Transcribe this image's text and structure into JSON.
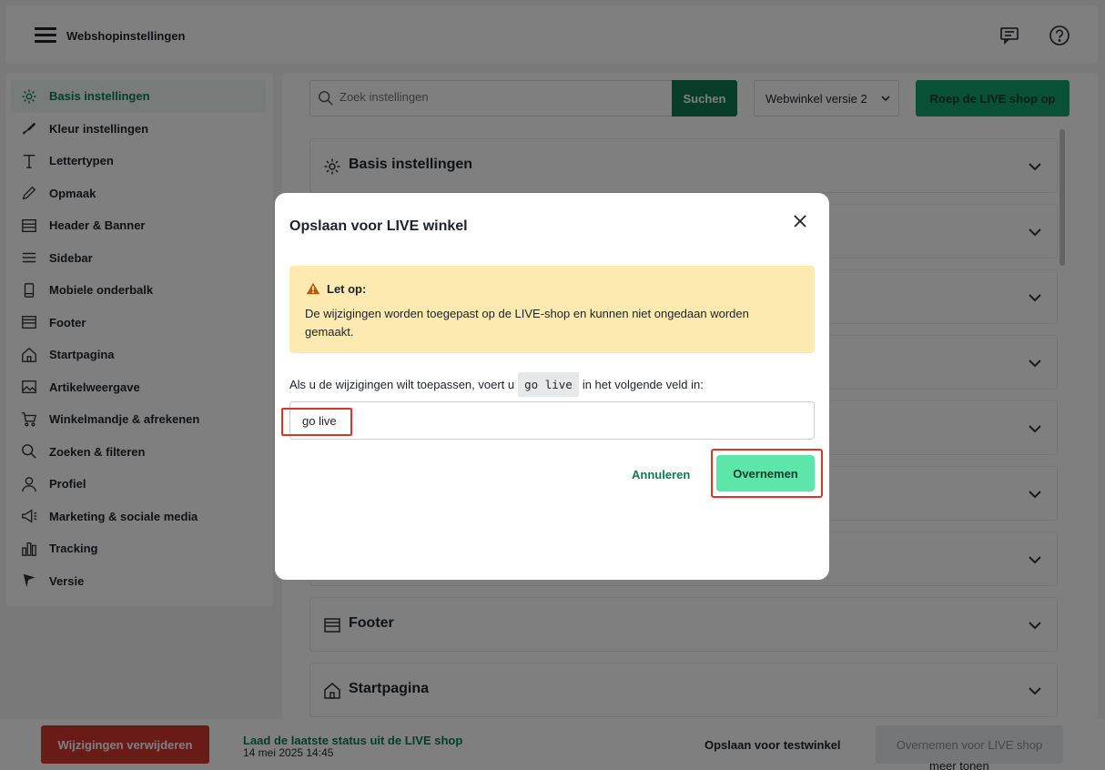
{
  "header": {
    "title": "Webshopinstellingen",
    "icons": [
      "menu-icon",
      "chat-icon",
      "help-icon"
    ]
  },
  "sidebar": {
    "items": [
      {
        "label": "Basis instellingen",
        "icon": "gear-icon",
        "active": true
      },
      {
        "label": "Kleur instellingen",
        "icon": "brush-icon"
      },
      {
        "label": "Lettertypen",
        "icon": "font-icon"
      },
      {
        "label": "Opmaak",
        "icon": "pencil-icon"
      },
      {
        "label": "Header & Banner",
        "icon": "banner-icon"
      },
      {
        "label": "Sidebar",
        "icon": "list-icon"
      },
      {
        "label": "Mobiele onderbalk",
        "icon": "mobile-icon"
      },
      {
        "label": "Footer",
        "icon": "footer-icon"
      },
      {
        "label": "Startpagina",
        "icon": "home-icon"
      },
      {
        "label": "Artikelweergave",
        "icon": "image-icon"
      },
      {
        "label": "Winkelmandje & afrekenen",
        "icon": "cart-icon"
      },
      {
        "label": "Zoeken & filteren",
        "icon": "search-icon"
      },
      {
        "label": "Profiel",
        "icon": "user-icon"
      },
      {
        "label": "Marketing & sociale media",
        "icon": "megaphone-icon"
      },
      {
        "label": "Tracking",
        "icon": "chart-icon"
      },
      {
        "label": "Versie",
        "icon": "flag-icon"
      }
    ]
  },
  "toolbar": {
    "search_placeholder": "Zoek instellingen",
    "search_button": "Suchen",
    "version_selected": "Webwinkel versie 2",
    "live_button": "Roep de LIVE shop op"
  },
  "sections": [
    {
      "title": "Basis instellingen",
      "icon": "gear-icon"
    },
    {
      "title": "Footer",
      "icon": "footer-icon"
    },
    {
      "title": "Startpagina",
      "icon": "home-icon"
    }
  ],
  "footer": {
    "delete_button": "Wijzigingen verwijderen",
    "load_link": "Laad de laatste status uit de LIVE shop",
    "load_time": "14 mei 2025 14:45",
    "save_test": "Opslaan voor testwinkel",
    "take_live": "Overnemen voor LIVE shop",
    "more": "meer tonen"
  },
  "modal": {
    "title": "Opslaan voor LIVE winkel",
    "warning_title": "Let op:",
    "warning_text": "De wijzigingen worden toegepast op de LIVE-shop en kunnen niet ongedaan worden gemaakt.",
    "instruction_before": "Als u de wijzigingen wilt toepassen, voert u",
    "instruction_code": "go live",
    "instruction_after": "in het volgende veld in:",
    "input_value": "go live",
    "cancel_label": "Annuleren",
    "confirm_label": "Overnemen"
  },
  "colors": {
    "brand_green": "#0e7a52",
    "confirm_green": "#5ce6aa",
    "warning_bg": "#fdeab1",
    "danger_red": "#d4362f",
    "highlight_red": "#e0342a"
  }
}
